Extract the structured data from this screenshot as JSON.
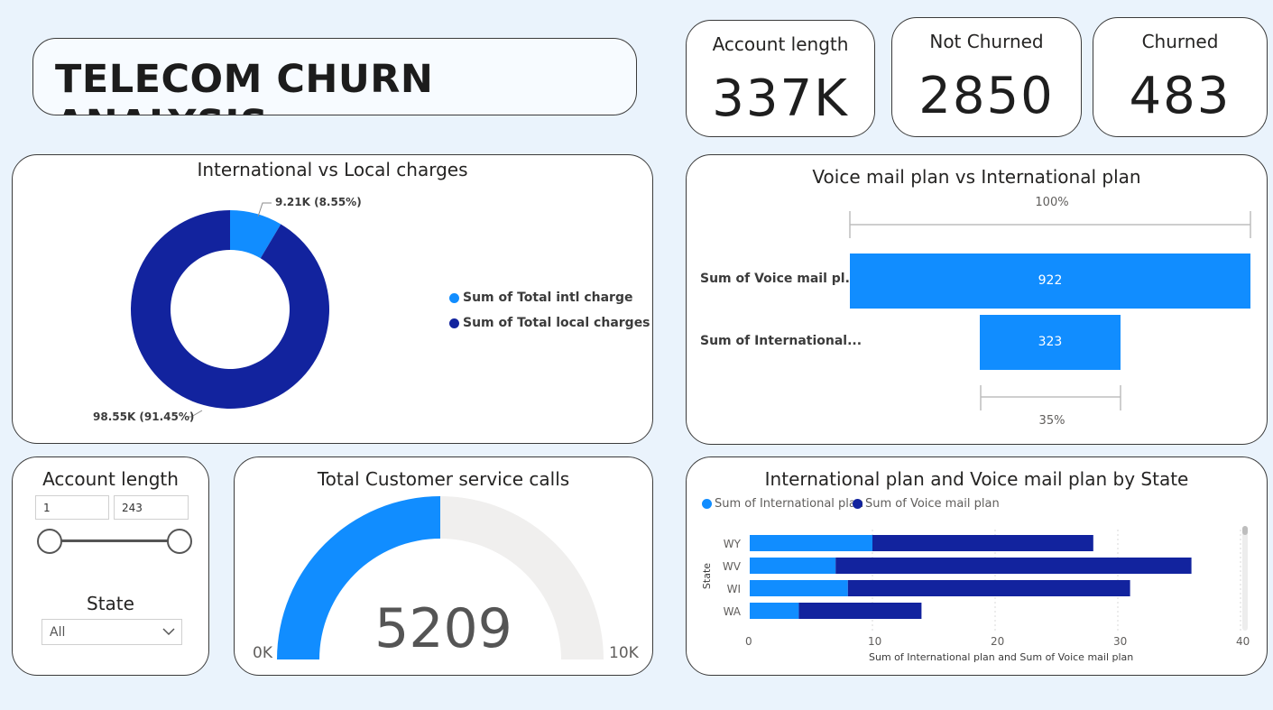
{
  "title": "TELECOM CHURN ANALYSIS",
  "kpis": {
    "account_length": {
      "label": "Account length",
      "value": "337K"
    },
    "not_churned": {
      "label": "Not Churned",
      "value": "2850"
    },
    "churned": {
      "label": "Churned",
      "value": "483"
    }
  },
  "colors": {
    "light_blue": "#118dff",
    "dark_blue": "#12239e",
    "gauge_bg": "#f0efee"
  },
  "donut": {
    "title": "International vs Local charges",
    "legend": [
      "Sum of Total intl charge",
      "Sum of Total local charges"
    ],
    "labels": {
      "intl": "9.21K (8.55%)",
      "local": "98.55K (91.45%)"
    }
  },
  "funnel": {
    "title": "Voice mail plan vs International plan",
    "top_pct": "100%",
    "bottom_pct": "35%",
    "categories": [
      "Sum of Voice mail pl...",
      "Sum of International..."
    ],
    "value_labels": [
      "922",
      "323"
    ]
  },
  "slicer": {
    "title": "Account length",
    "min_value": "1",
    "max_value": "243",
    "state_title": "State",
    "state_value": "All"
  },
  "gauge": {
    "title": "Total Customer service calls",
    "value_label": "5209",
    "min_label": "0K",
    "max_label": "10K"
  },
  "stacked": {
    "title": "International plan and Voice mail plan by State",
    "legend": [
      "Sum of International plan",
      "Sum of Voice mail plan"
    ],
    "y_axis_title": "State",
    "x_axis_title": "Sum of International plan and Sum of Voice mail plan",
    "x_ticks": [
      "0",
      "10",
      "20",
      "30",
      "40"
    ]
  },
  "chart_data": [
    {
      "type": "pie",
      "title": "International vs Local charges",
      "categories": [
        "Sum of Total intl charge",
        "Sum of Total local charges"
      ],
      "values": [
        9210,
        98550
      ],
      "percent": [
        8.55,
        91.45
      ],
      "legend": "right"
    },
    {
      "type": "bar",
      "title": "Voice mail plan vs International plan",
      "categories": [
        "Sum of Voice mail pl...",
        "Sum of International..."
      ],
      "values": [
        922,
        323
      ]
    },
    {
      "type": "bar",
      "title": "International plan and Voice mail plan by State",
      "categories": [
        "WY",
        "WV",
        "WI",
        "WA"
      ],
      "series": [
        {
          "name": "Sum of International plan",
          "values": [
            10,
            7,
            8,
            4
          ]
        },
        {
          "name": "Sum of Voice mail plan",
          "values": [
            18,
            29,
            23,
            10
          ]
        }
      ],
      "xlabel": "Sum of International plan and Sum of Voice mail plan",
      "ylabel": "State",
      "xlim": [
        0,
        40
      ],
      "legend": "top-left",
      "grid": true
    }
  ]
}
